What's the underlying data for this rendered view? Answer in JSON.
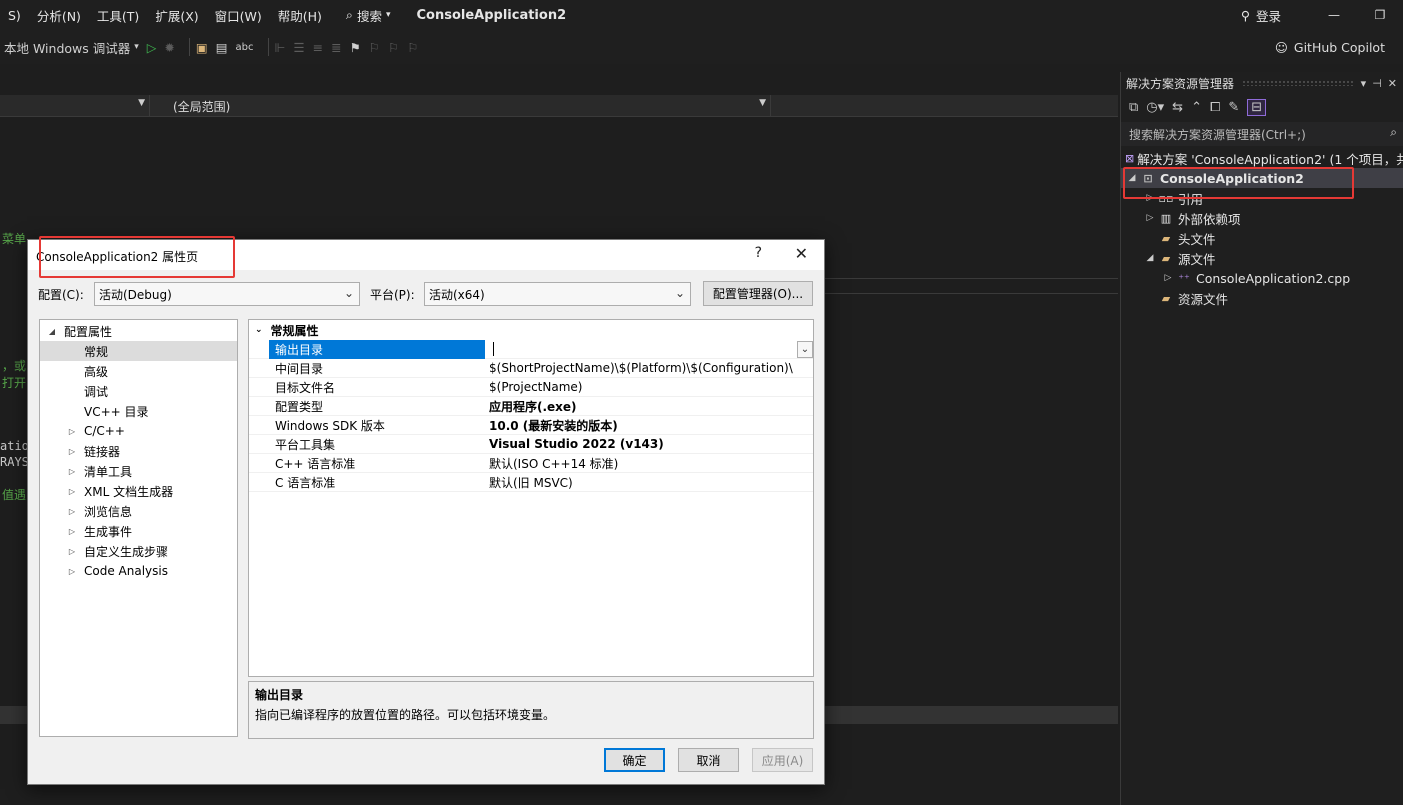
{
  "menu": {
    "items": [
      "S)",
      "分析(N)",
      "工具(T)",
      "扩展(X)",
      "窗口(W)",
      "帮助(H)"
    ],
    "search_label": "搜索",
    "app_title": "ConsoleApplication2",
    "login_label": "登录"
  },
  "toolbar": {
    "debugger_label": "本地 Windows 调试器",
    "copilot_label": "GitHub Copilot"
  },
  "editor": {
    "scope_label": "(全局范围)",
    "fragments": [
      "菜单",
      "，或",
      "打开",
      "ation",
      "RAYS",
      "值遇"
    ]
  },
  "solution_explorer": {
    "title": "解决方案资源管理器",
    "search_placeholder": "搜索解决方案资源管理器(Ctrl+;)",
    "solution_label": "解决方案 'ConsoleApplication2' (1 个项目，共",
    "project_label": "ConsoleApplication2",
    "nodes": {
      "references": "引用",
      "external_deps": "外部依赖项",
      "headers": "头文件",
      "sources": "源文件",
      "cpp_file": "ConsoleApplication2.cpp",
      "resources": "资源文件"
    }
  },
  "dialog": {
    "title": "ConsoleApplication2 属性页",
    "help": "?",
    "config_label": "配置(C):",
    "config_value": "活动(Debug)",
    "platform_label": "平台(P):",
    "platform_value": "活动(x64)",
    "config_manager": "配置管理器(O)...",
    "nav": {
      "root": "配置属性",
      "items": [
        "常规",
        "高级",
        "调试",
        "VC++ 目录"
      ],
      "groups": [
        "C/C++",
        "链接器",
        "清单工具",
        "XML 文档生成器",
        "浏览信息",
        "生成事件",
        "自定义生成步骤",
        "Code Analysis"
      ]
    },
    "grid": {
      "category": "常规属性",
      "rows": [
        {
          "name": "输出目录",
          "value": ""
        },
        {
          "name": "中间目录",
          "value": "$(ShortProjectName)\\$(Platform)\\$(Configuration)\\"
        },
        {
          "name": "目标文件名",
          "value": "$(ProjectName)"
        },
        {
          "name": "配置类型",
          "value": "应用程序(.exe)"
        },
        {
          "name": "Windows SDK 版本",
          "value": "10.0 (最新安装的版本)"
        },
        {
          "name": "平台工具集",
          "value": "Visual Studio 2022 (v143)"
        },
        {
          "name": "C++ 语言标准",
          "value": "默认(ISO C++14 标准)"
        },
        {
          "name": "C 语言标准",
          "value": "默认(旧 MSVC)"
        }
      ]
    },
    "description": {
      "title": "输出目录",
      "text": "指向已编译程序的放置位置的路径。可以包括环境变量。"
    },
    "buttons": {
      "ok": "确定",
      "cancel": "取消",
      "apply": "应用(A)"
    }
  },
  "colors": {
    "accent": "#0078d7",
    "highlight_box": "#e53935",
    "ide_bg": "#1e1e1e"
  }
}
